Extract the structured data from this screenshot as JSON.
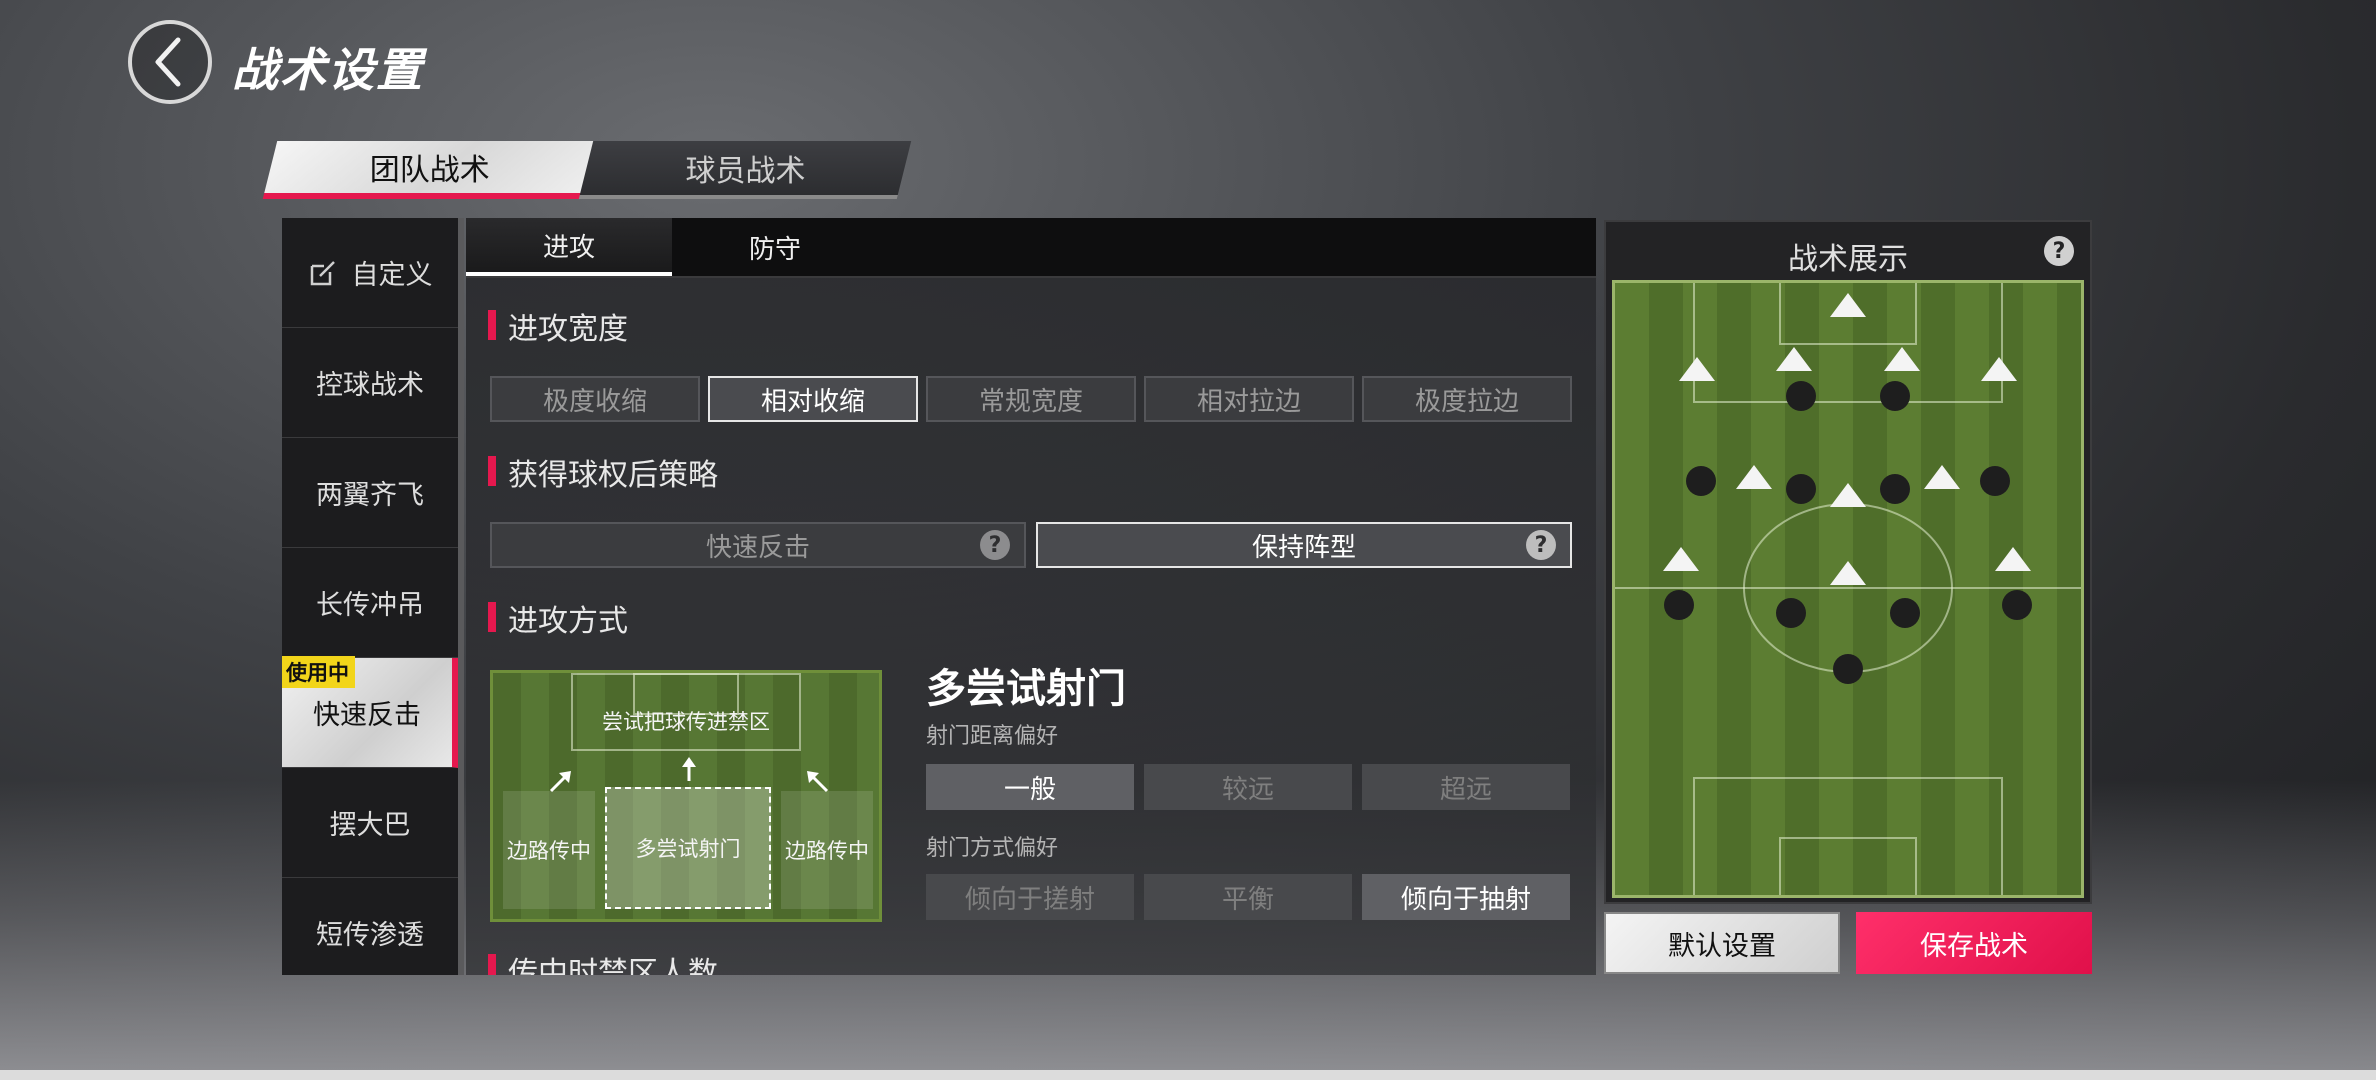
{
  "header": {
    "title": "战术设置"
  },
  "top_tabs": [
    {
      "label": "团队战术",
      "active": true
    },
    {
      "label": "球员战术",
      "active": false
    }
  ],
  "sidebar": {
    "in_use_label": "使用中",
    "items": [
      {
        "label": "自定义",
        "icon": "edit-icon"
      },
      {
        "label": "控球战术"
      },
      {
        "label": "两翼齐飞"
      },
      {
        "label": "长传冲吊"
      },
      {
        "label": "快速反击",
        "active": true
      },
      {
        "label": "摆大巴"
      },
      {
        "label": "短传渗透"
      }
    ]
  },
  "center": {
    "tabs": [
      {
        "label": "进攻",
        "active": true
      },
      {
        "label": "防守",
        "active": false
      }
    ],
    "attack_width": {
      "title": "进攻宽度",
      "options": [
        "极度收缩",
        "相对收缩",
        "常规宽度",
        "相对拉边",
        "极度拉边"
      ],
      "selected": "相对收缩"
    },
    "possession_strategy": {
      "title": "获得球权后策略",
      "options": [
        "快速反击",
        "保持阵型"
      ],
      "selected": "保持阵型"
    },
    "attack_method": {
      "title": "进攻方式",
      "zones": {
        "box": "尝试把球传进禁区",
        "left": "边路传中",
        "center": "多尝试射门",
        "right": "边路传中"
      },
      "selected_title": "多尝试射门",
      "shot_distance": {
        "label": "射门距离偏好",
        "options": [
          "一般",
          "较远",
          "超远"
        ],
        "selected": "一般"
      },
      "shot_style": {
        "label": "射门方式偏好",
        "options": [
          "倾向于搓射",
          "平衡",
          "倾向于抽射"
        ],
        "selected": "倾向于抽射"
      }
    },
    "next_section_title": "传中时禁区人数"
  },
  "tactics_display": {
    "title": "战术展示",
    "help": "?"
  },
  "buttons": {
    "default": "默认设置",
    "save": "保存战术"
  },
  "colors": {
    "accent": "#e5184e",
    "badge": "#f2d51a",
    "pitch": "#5c7d32"
  }
}
